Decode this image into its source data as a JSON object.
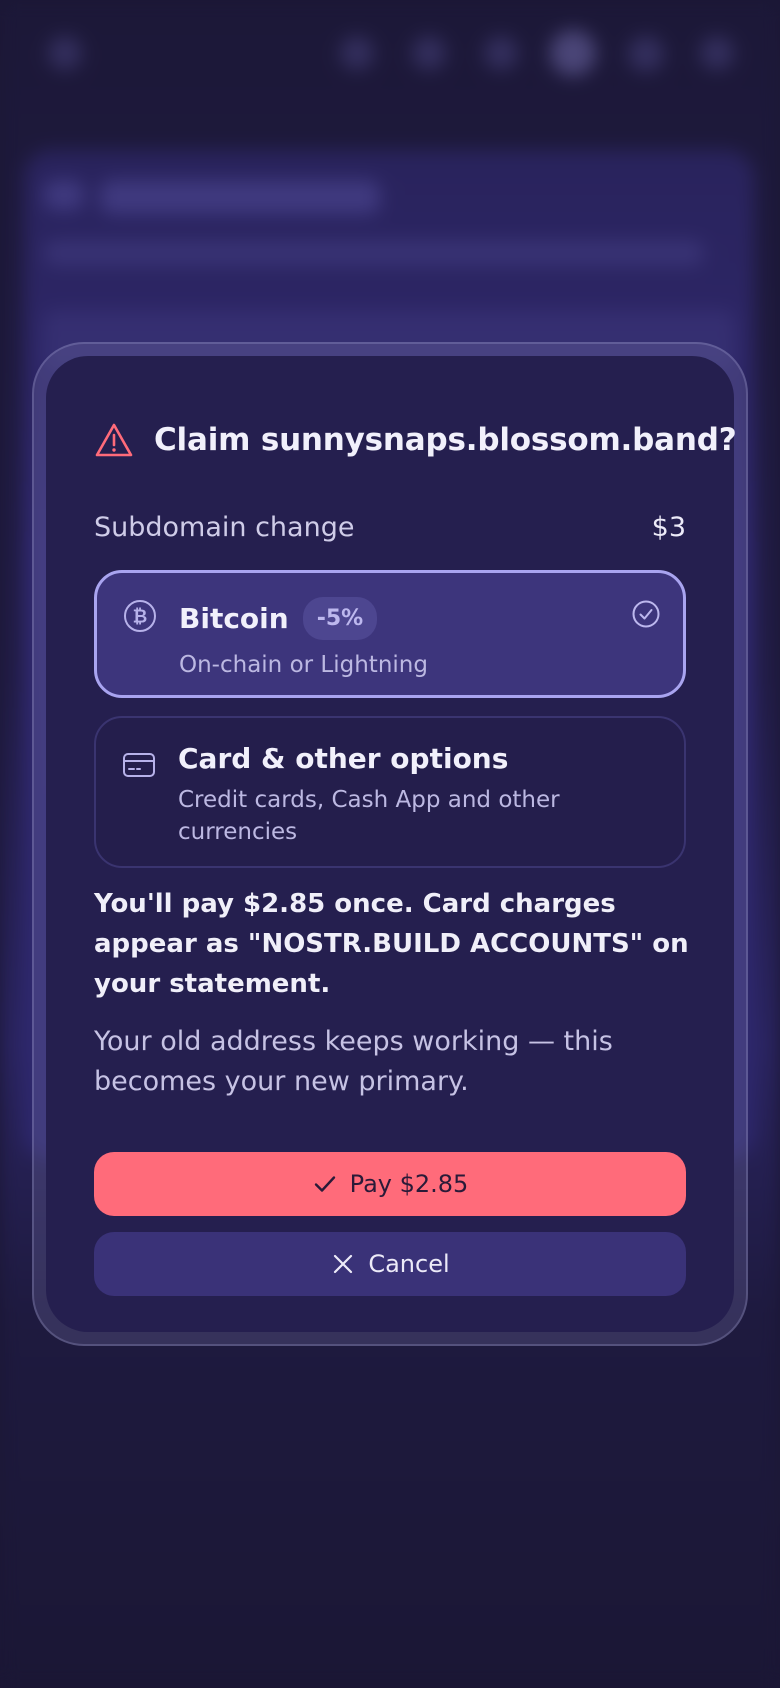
{
  "dialog": {
    "title": "Claim sunnysnaps.blossom.band?",
    "change_label": "Subdomain change",
    "change_price": "$3",
    "options": [
      {
        "title": "Bitcoin",
        "badge": "-5%",
        "subtitle": "On-chain or Lightning",
        "selected": true,
        "icon": "bitcoin-icon"
      },
      {
        "title": "Card & other options",
        "subtitle": "Credit cards, Cash App and other currencies",
        "selected": false,
        "icon": "credit-card-icon"
      }
    ],
    "pay_note": "You'll pay $2.85 once. Card charges appear as \"NOSTR.BUILD ACCOUNTS\" on your statement.",
    "old_note": "Your old address keeps working — this becomes your new primary.",
    "pay_button": "Pay $2.85",
    "cancel_button": "Cancel"
  },
  "colors": {
    "accent": "#ff6b7a",
    "selected_border": "#a9a4f0",
    "dialog_bg": "#251f4f",
    "warning": "#ff6b7a"
  }
}
